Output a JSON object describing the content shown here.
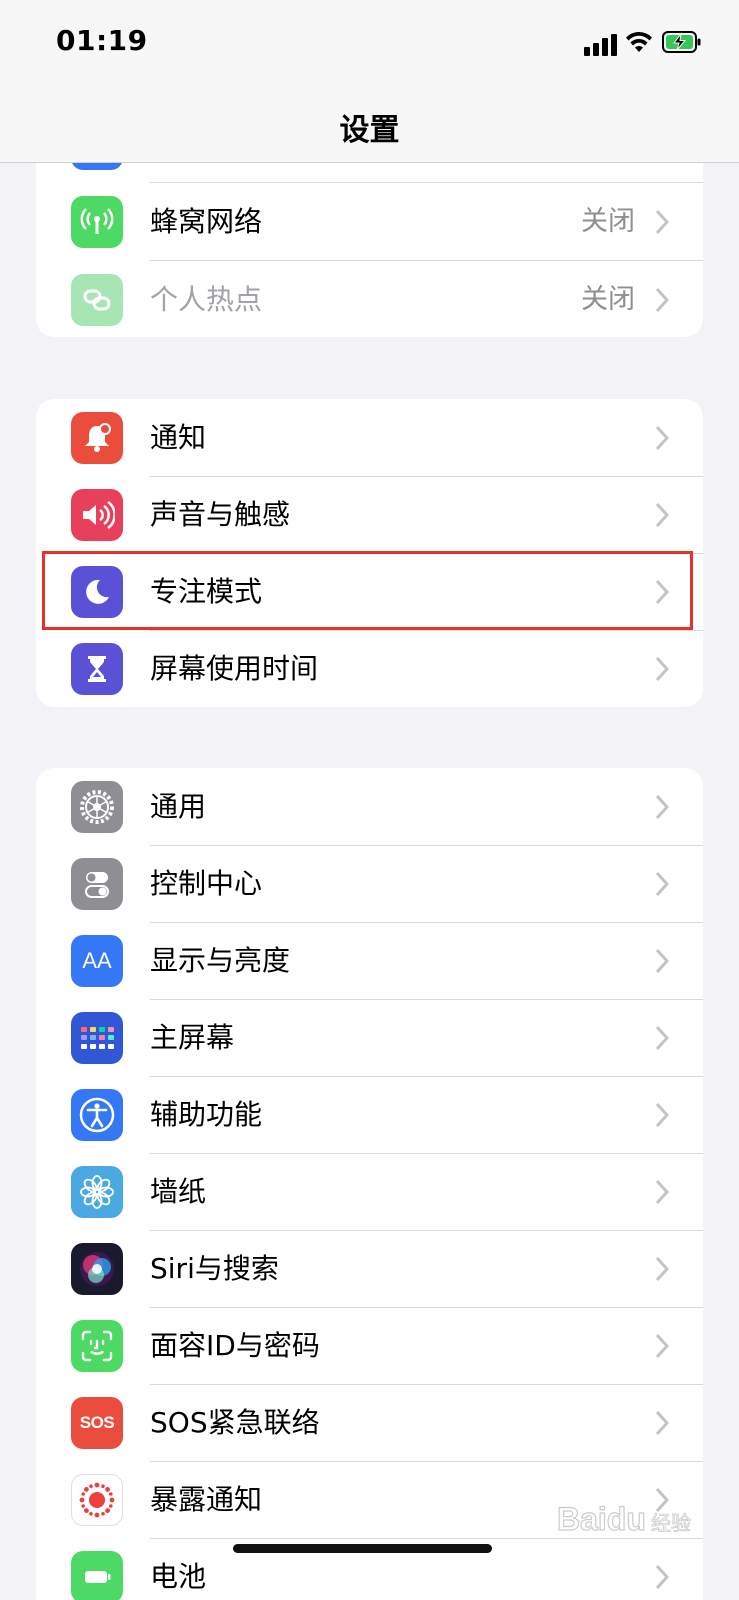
{
  "status_bar": {
    "time": "01:19"
  },
  "nav": {
    "title": "设置"
  },
  "group1": [
    {
      "label": "蜂窝网络",
      "value": "关闭",
      "icon": "cellular-icon",
      "color": "#4cd964"
    },
    {
      "label": "个人热点",
      "value": "关闭",
      "icon": "hotspot-icon",
      "color": "#a8e5b5",
      "disabled": true
    }
  ],
  "group2": [
    {
      "label": "通知",
      "icon": "bell-icon",
      "color": "#eb4d3d"
    },
    {
      "label": "声音与触感",
      "icon": "speaker-icon",
      "color": "#e8405a"
    },
    {
      "label": "专注模式",
      "icon": "moon-icon",
      "color": "#5a51d6",
      "highlighted": true
    },
    {
      "label": "屏幕使用时间",
      "icon": "hourglass-icon",
      "color": "#5a51d6"
    }
  ],
  "group3": [
    {
      "label": "通用",
      "icon": "gear-icon",
      "color": "#8e8e93"
    },
    {
      "label": "控制中心",
      "icon": "toggles-icon",
      "color": "#8e8e93"
    },
    {
      "label": "显示与亮度",
      "icon": "text-size-icon",
      "color": "#3478f6"
    },
    {
      "label": "主屏幕",
      "icon": "app-grid-icon",
      "color": "#2f57d6"
    },
    {
      "label": "辅助功能",
      "icon": "accessibility-icon",
      "color": "#3478f6"
    },
    {
      "label": "墙纸",
      "icon": "flower-icon",
      "color": "#4aa9e0"
    },
    {
      "label": "Siri与搜索",
      "icon": "siri-icon",
      "color": "#1a1a2e"
    },
    {
      "label": "面容ID与密码",
      "icon": "face-id-icon",
      "color": "#4cd964"
    },
    {
      "label": "SOS紧急联络",
      "icon": "sos-icon",
      "color": "#eb4d3d",
      "icon_text": "SOS"
    },
    {
      "label": "暴露通知",
      "icon": "exposure-icon",
      "color": "#ffffff"
    },
    {
      "label": "电池",
      "icon": "battery-icon",
      "color": "#4cd964"
    }
  ],
  "icons_text": {
    "display": "AA"
  },
  "watermark": "Baidu 经验"
}
